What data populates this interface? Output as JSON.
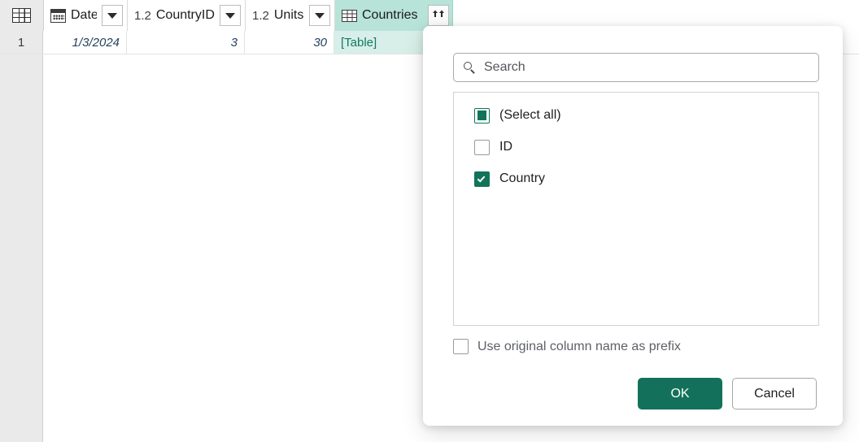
{
  "grid": {
    "corner_icon": "table-icon",
    "columns": [
      {
        "id": "date",
        "label": "Date",
        "type_icon": "calendar-icon",
        "type_prefix": "",
        "control": "dropdown"
      },
      {
        "id": "countryid",
        "label": "CountryID",
        "type_icon": "",
        "type_prefix": "1.2",
        "control": "dropdown"
      },
      {
        "id": "units",
        "label": "Units",
        "type_icon": "",
        "type_prefix": "1.2",
        "control": "dropdown"
      },
      {
        "id": "countries",
        "label": "Countries",
        "type_icon": "table-icon",
        "type_prefix": "",
        "control": "expand"
      }
    ],
    "rows": [
      {
        "number": "1",
        "date": "1/3/2024",
        "countryid": "3",
        "units": "30",
        "countries": "[Table]"
      }
    ],
    "highlight_color": "#b7e3d8",
    "link_color": "#11795f"
  },
  "dialog": {
    "search": {
      "placeholder": "Search",
      "value": "",
      "icon": "search-icon"
    },
    "columns_list": [
      {
        "label": "(Select all)",
        "state": "indeterminate"
      },
      {
        "label": "ID",
        "state": "unchecked"
      },
      {
        "label": "Country",
        "state": "checked"
      }
    ],
    "prefix_option": {
      "label": "Use original column name as prefix",
      "state": "unchecked"
    },
    "buttons": {
      "ok": "OK",
      "cancel": "Cancel"
    },
    "accent_color": "#13715B"
  }
}
